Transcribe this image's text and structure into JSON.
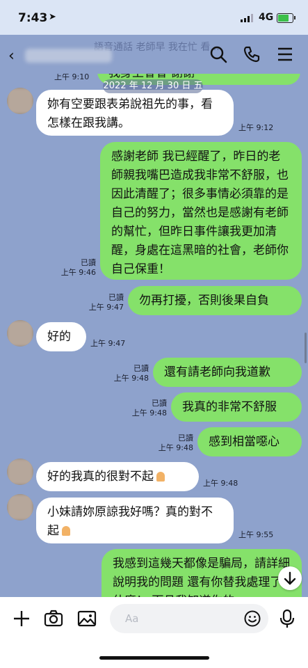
{
  "status_bar": {
    "time": "7:43",
    "network": "4G",
    "battery_level": 0.85
  },
  "header": {
    "bg_peek_text": "語音通話 老師早 我在忙 看...",
    "icons": [
      "search-icon",
      "phone-icon",
      "menu-icon"
    ]
  },
  "chat": {
    "date_separator": "2022 年 12 月 30 日 五",
    "top_partial": {
      "text": "我身上會會 謝謝",
      "time": "上午 9:10"
    },
    "messages": [
      {
        "side": "in",
        "text": "妳有空要跟表弟說祖先的事，看怎樣在跟我講。",
        "time": "上午 9:12"
      },
      {
        "side": "out",
        "read": "已讀",
        "time": "上午 9:46",
        "text": "感謝老師 我已經醒了，昨日的老師親我嘴巴造成我非常不舒服，也因此清醒了；很多事情必須靠的是自己的努力，當然也是感謝有老師的幫忙，但昨日事件讓我更加清醒，身處在這黑暗的社會，老師你自己保重！"
      },
      {
        "side": "out",
        "read": "已讀",
        "time": "上午 9:47",
        "text": "勿再打擾，否則後果自負"
      },
      {
        "side": "in",
        "text": "好的",
        "time": "上午 9:47"
      },
      {
        "side": "out",
        "read": "已讀",
        "time": "上午 9:48",
        "text": "還有請老師向我道歉"
      },
      {
        "side": "out",
        "read": "已讀",
        "time": "上午 9:48",
        "text": "我真的非常不舒服"
      },
      {
        "side": "out",
        "read": "已讀",
        "time": "上午 9:48",
        "text": "感到相當噁心"
      },
      {
        "side": "in",
        "text": "好的我真的很對不起",
        "time": "上午 9:48"
      },
      {
        "side": "in",
        "text": "小妹請妳原諒我好嗎？真的對不起",
        "time": "上午 9:55"
      },
      {
        "side": "out",
        "text": "我感到這幾天都像是騙局，請詳細說明我的問題 還有你替我處理了什麼！ 而且我知道你的"
      }
    ]
  },
  "input": {
    "placeholder": "Aa"
  },
  "colors": {
    "chat_bg": "#8ea2cc",
    "bubble_out": "#85e16a",
    "bubble_in": "#ffffff"
  }
}
